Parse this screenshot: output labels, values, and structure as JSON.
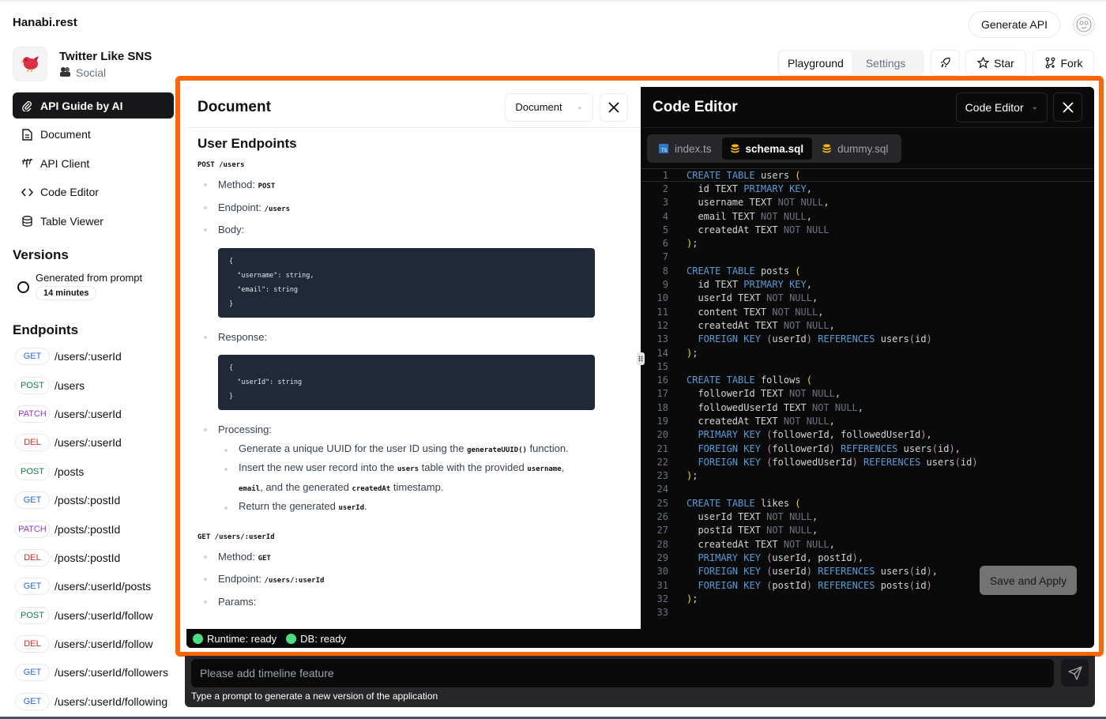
{
  "app": {
    "brand": "Hanabi.rest"
  },
  "project": {
    "name": "Twitter Like SNS",
    "category": "Social"
  },
  "sidebar": {
    "nav": [
      {
        "label": "API Guide by AI",
        "icon": "paperclip-icon",
        "active": true
      },
      {
        "label": "Document",
        "icon": "document-icon"
      },
      {
        "label": "API Client",
        "icon": "antenna-icon"
      },
      {
        "label": "Code Editor",
        "icon": "code-icon"
      },
      {
        "label": "Table Viewer",
        "icon": "database-icon"
      }
    ],
    "versions_title": "Versions",
    "version": {
      "label": "Generated from prompt",
      "age": "14 minutes"
    },
    "endpoints_title": "Endpoints",
    "endpoints": [
      {
        "method": "GET",
        "path": "/users/:userId"
      },
      {
        "method": "POST",
        "path": "/users"
      },
      {
        "method": "PATCH",
        "path": "/users/:userId"
      },
      {
        "method": "DEL",
        "path": "/users/:userId"
      },
      {
        "method": "POST",
        "path": "/posts"
      },
      {
        "method": "GET",
        "path": "/posts/:postId"
      },
      {
        "method": "PATCH",
        "path": "/posts/:postId"
      },
      {
        "method": "DEL",
        "path": "/posts/:postId"
      },
      {
        "method": "GET",
        "path": "/users/:userId/posts"
      },
      {
        "method": "POST",
        "path": "/users/:userId/follow"
      },
      {
        "method": "DEL",
        "path": "/users/:userId/follow"
      },
      {
        "method": "GET",
        "path": "/users/:userId/followers"
      },
      {
        "method": "GET",
        "path": "/users/:userId/following"
      }
    ],
    "method_colors": {
      "GET": "#2563eb",
      "POST": "#15803d",
      "PATCH": "#9333ea",
      "DEL": "#dc2626"
    }
  },
  "header": {
    "generate_label": "Generate API",
    "tabs": [
      {
        "label": "Playground",
        "active": true
      },
      {
        "label": "Settings"
      }
    ],
    "star_label": "Star",
    "fork_label": "Fork"
  },
  "document": {
    "title": "Document",
    "select_value": "Document",
    "section": "User Endpoints",
    "endpoint1": {
      "heading": "POST /users",
      "method_label": "Method: ",
      "method": "POST",
      "endpoint_label": "Endpoint: ",
      "endpoint": "/users",
      "body_label": "Body:",
      "body_code": "{\n  \"username\": string,\n  \"email\": string\n}",
      "response_label": "Response:",
      "response_code": "{\n  \"userId\": string\n}",
      "processing_label": "Processing:",
      "steps": {
        "s1a": "Generate a unique UUID for the user ID using the ",
        "s1code": "generateUUID()",
        "s1b": " function.",
        "s2a": "Insert the new user record into the ",
        "s2code1": "users",
        "s2b": " table with the provided ",
        "s2code2": "username",
        "s2c": ",",
        "s2code3": "email",
        "s2d": ", and the generated ",
        "s2code4": "createdAt",
        "s2e": " timestamp.",
        "s3a": "Return the generated ",
        "s3code": "userId",
        "s3b": "."
      }
    },
    "endpoint2": {
      "heading": "GET /users/:userId",
      "method_label": "Method: ",
      "method": "GET",
      "endpoint_label": "Endpoint: ",
      "endpoint": "/users/:userId",
      "params_label": "Params:"
    }
  },
  "editor": {
    "title": "Code Editor",
    "select_value": "Code Editor",
    "files": [
      {
        "name": "index.ts",
        "icon": "typescript-icon"
      },
      {
        "name": "schema.sql",
        "icon": "database-icon",
        "active": true
      },
      {
        "name": "dummy.sql",
        "icon": "database-icon"
      }
    ],
    "lines": [
      "CREATE TABLE users (",
      "  id TEXT PRIMARY KEY,",
      "  username TEXT NOT NULL,",
      "  email TEXT NOT NULL,",
      "  createdAt TEXT NOT NULL",
      ");",
      "",
      "CREATE TABLE posts (",
      "  id TEXT PRIMARY KEY,",
      "  userId TEXT NOT NULL,",
      "  content TEXT NOT NULL,",
      "  createdAt TEXT NOT NULL,",
      "  FOREIGN KEY (userId) REFERENCES users(id)",
      ");",
      "",
      "CREATE TABLE follows (",
      "  followerId TEXT NOT NULL,",
      "  followedUserId TEXT NOT NULL,",
      "  createdAt TEXT NOT NULL,",
      "  PRIMARY KEY (followerId, followedUserId),",
      "  FOREIGN KEY (followerId) REFERENCES users(id),",
      "  FOREIGN KEY (followedUserId) REFERENCES users(id)",
      ");",
      "",
      "CREATE TABLE likes (",
      "  userId TEXT NOT NULL,",
      "  postId TEXT NOT NULL,",
      "  createdAt TEXT NOT NULL,",
      "  PRIMARY KEY (userId, postId),",
      "  FOREIGN KEY (userId) REFERENCES users(id),",
      "  FOREIGN KEY (postId) REFERENCES posts(id)",
      ");",
      ""
    ],
    "save_label": "Save and Apply"
  },
  "status": {
    "runtime": "Runtime: ready",
    "db": "DB: ready",
    "ok_color": "#4ade80"
  },
  "prompt": {
    "value": "Please add timeline feature",
    "hint": "Type a prompt to generate a new version of the application"
  },
  "accent": "#ff6600"
}
